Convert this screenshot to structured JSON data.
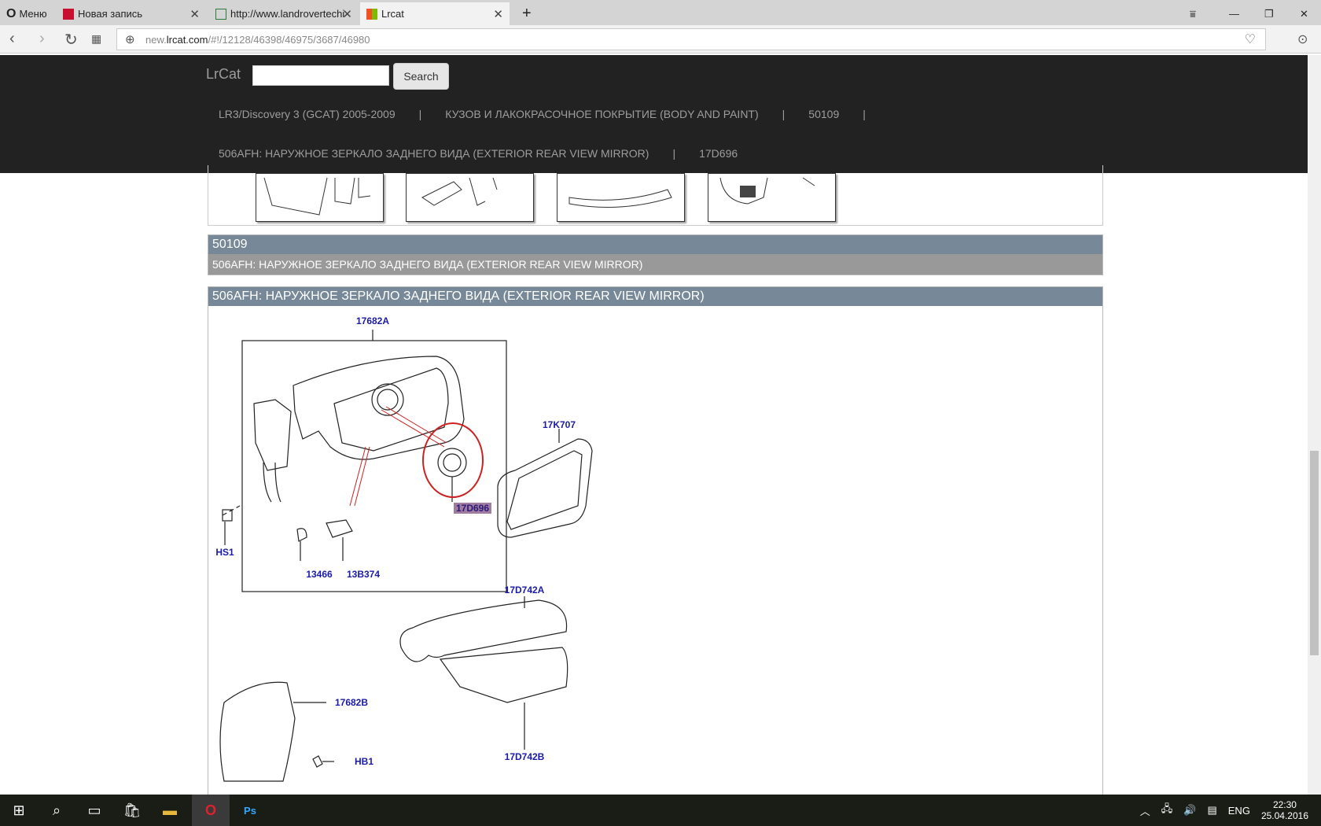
{
  "browser": {
    "menu_label": "Меню",
    "tabs": [
      {
        "title": "Новая запись",
        "active": false
      },
      {
        "title": "http://www.landrovertechi",
        "active": false
      },
      {
        "title": "Lrcat",
        "active": true
      }
    ],
    "url_prefix": "new.",
    "url_host": "lrcat.com",
    "url_path": "/#!/12128/46398/46975/3687/46980"
  },
  "header": {
    "brand": "LrCat",
    "search_value": "",
    "search_button": "Search",
    "crumbs_row1": [
      "LR3/Discovery 3 (GCAT) 2005-2009",
      "|",
      "КУЗОВ И ЛАКОКРАСОЧНОЕ ПОКРЫТИЕ (BODY AND PAINT)",
      "|",
      "50109",
      "|"
    ],
    "crumbs_row2": [
      "506AFH: НАРУЖНОЕ ЗЕРКАЛО ЗАДНЕГО ВИДА (EXTERIOR REAR VIEW MIRROR)",
      "|",
      "17D696"
    ]
  },
  "group_panel": {
    "title": "50109",
    "item": "506AFH: НАРУЖНОЕ ЗЕРКАЛО ЗАДНЕГО ВИДА (EXTERIOR REAR VIEW MIRROR)"
  },
  "diagram_panel": {
    "title": "506AFH: НАРУЖНОЕ ЗЕРКАЛО ЗАДНЕГО ВИДА (EXTERIOR REAR VIEW MIRROR)",
    "parts": [
      "17682A",
      "17K707",
      "17D696",
      "HS1",
      "13466",
      "13B374",
      "17D742A",
      "17D742B",
      "17682B",
      "HB1"
    ],
    "selected_part": "17D696",
    "highlight_color": "#cc2222"
  },
  "taskbar": {
    "language": "ENG",
    "time": "22:30",
    "date": "25.04.2016"
  }
}
